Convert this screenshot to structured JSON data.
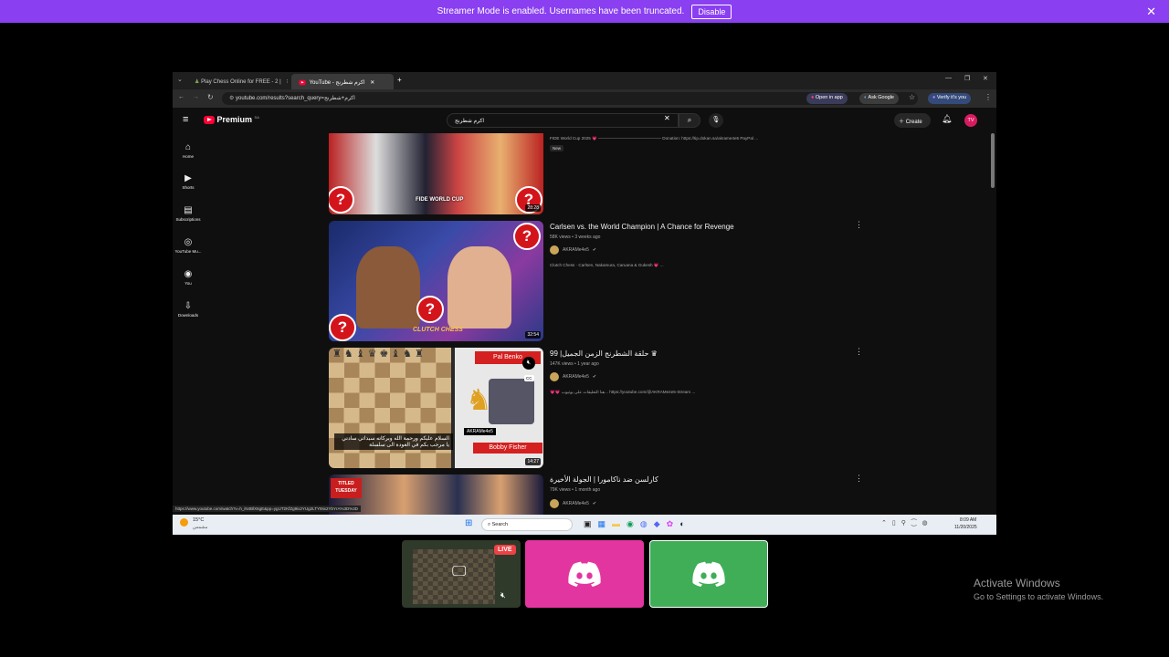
{
  "banner": {
    "text": "Streamer Mode is enabled. Usernames have been truncated.",
    "button": "Disable"
  },
  "browser": {
    "tabs": [
      {
        "label": "Play Chess Online for FREE - 2 | "
      },
      {
        "label": "YouTube - اكرم شطرنج"
      }
    ],
    "url": "youtube.com/results?search_query=اكرم+شطرنج",
    "open_in_app": "Open in app",
    "ask_google": "Ask Google",
    "verify": "Verify it's you"
  },
  "youtube": {
    "logo": "Premium",
    "logo_sup": "SA",
    "search_value": "اكرم شطرنج",
    "create": "Create",
    "avatar": "TV",
    "sidebar": [
      {
        "icon": "home-icon",
        "glyph": "⌂",
        "label": "Home"
      },
      {
        "icon": "shorts-icon",
        "glyph": "▶",
        "label": "Shorts"
      },
      {
        "icon": "subscriptions-icon",
        "glyph": "▤",
        "label": "Subscriptions"
      },
      {
        "icon": "youtube-music-icon",
        "glyph": "◎",
        "label": "YouTube Mu..."
      },
      {
        "icon": "you-icon",
        "glyph": "◉",
        "label": "You"
      },
      {
        "icon": "downloads-icon",
        "glyph": "⇩",
        "label": "Downloads"
      }
    ],
    "video0": {
      "desc": "FIDE World Cup 2025 💗 ——————————————— Donation: https://tip.dokan.sa/akrame4e5 PayPal ...",
      "badge": "New",
      "duration": "28:28",
      "overlay": "FIDE WORLD CUP"
    },
    "video1": {
      "title": "Carlsen vs. the World Champion | A Chance for Revenge",
      "meta": "58K views • 3 weeks ago",
      "channel": "AKRAMe4e5",
      "desc": "Clutch Chess · Carlsen, Nakamura, Caruana & Gukesh 💗 ...",
      "duration": "32:54",
      "overlay": "CLUTCH CHESS"
    },
    "video2": {
      "title": "99 |حلقة الشطرنج الزمن الجميل ♛",
      "meta": "147K views • 1 year ago",
      "channel": "AKRAMe4e5",
      "desc": "💗💗 هنا التعليقات على يوتيوب... https://youtube.com/@AKRAMe4e5-Stream ...",
      "duration": "14:27",
      "name1": "Pal Benko",
      "name2": "Bobby Fisher",
      "subtitle": "السلام عليكم ورحمة الله وبركاته سيداتي سادتي يا مرحب بكم في العودة الى سلسلة",
      "cc": "CC",
      "tag": "AKRAMe4e5"
    },
    "video3": {
      "title": "كارلسن ضد ناكامورا | الجولة الأخيرة",
      "meta": "79K views • 1 month ago",
      "channel": "AKRAMe4e5",
      "overlay": "TITLED TUESDAY"
    },
    "status_url": "https://www.youtube.com/watch?v=h_iN4BlX6gE&pp=ygUT2KfZg9ix2YUg2LTYt9ix2YbYrA%3D%3D"
  },
  "taskbar": {
    "weather": "15°C",
    "weather_sub": "مشمس",
    "search": "Search",
    "time": "8:09 AM",
    "date": "11/20/2025"
  },
  "tiles": {
    "live": "LIVE"
  },
  "watermark": {
    "line1": "Activate Windows",
    "line2": "Go to Settings to activate Windows."
  },
  "colors": {
    "banner": "#8a3ff0",
    "discord_pink": "#e3359f",
    "discord_green": "#3fae57",
    "yt_red": "#ff0033"
  }
}
